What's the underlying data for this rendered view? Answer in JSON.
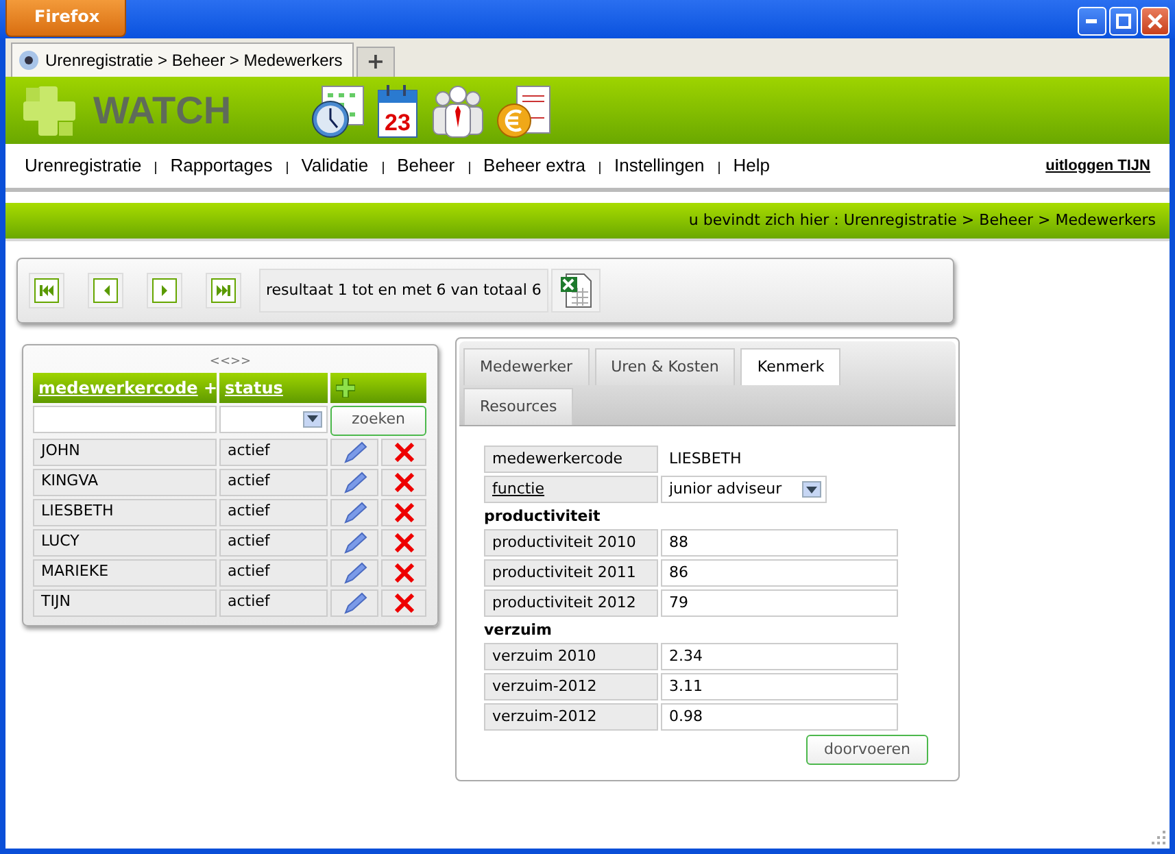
{
  "browser": {
    "menu_button": "Firefox",
    "tab_title": "Urenregistratie > Beheer > Medewerkers",
    "new_tab": "+"
  },
  "app": {
    "logo": "WATCH",
    "nav": [
      "Urenregistratie",
      "Rapportages",
      "Validatie",
      "Beheer",
      "Beheer extra",
      "Instellingen",
      "Help"
    ],
    "logout": "uitloggen TIJN",
    "breadcrumb": "u bevindt zich hier : Urenregistratie > Beheer > Medewerkers",
    "calendar_day": "23"
  },
  "pager": {
    "result": "resultaat 1 tot en met 6 van totaal 6"
  },
  "employees": {
    "scroller": "<<>>",
    "columns": [
      {
        "label": "medewerkercode",
        "sort": "+"
      },
      {
        "label": "status"
      }
    ],
    "search_button": "zoeken",
    "rows": [
      {
        "code": "JOHN",
        "status": "actief"
      },
      {
        "code": "KINGVA",
        "status": "actief"
      },
      {
        "code": "LIESBETH",
        "status": "actief"
      },
      {
        "code": "LUCY",
        "status": "actief"
      },
      {
        "code": "MARIEKE",
        "status": "actief"
      },
      {
        "code": "TIJN",
        "status": "actief"
      }
    ]
  },
  "detail": {
    "tabs": [
      {
        "label": "Medewerker",
        "selected": false
      },
      {
        "label": "Uren & Kosten",
        "selected": false
      },
      {
        "label": "Kenmerk",
        "selected": true
      },
      {
        "label": "Resources",
        "selected": false
      }
    ],
    "code_label": "medewerkercode",
    "code_value": "LIESBETH",
    "function_label": "functie",
    "function_value": "junior adviseur",
    "sections": [
      {
        "heading": "productiviteit",
        "fields": [
          {
            "label": "productiviteit 2010",
            "value": "88"
          },
          {
            "label": "productiviteit 2011",
            "value": "86"
          },
          {
            "label": "productiviteit 2012",
            "value": "79"
          }
        ]
      },
      {
        "heading": "verzuim",
        "fields": [
          {
            "label": "verzuim 2010",
            "value": "2.34"
          },
          {
            "label": "verzuim-2012",
            "value": "3.11"
          },
          {
            "label": "verzuim-2012",
            "value": "0.98"
          }
        ]
      }
    ],
    "submit": "doorvoeren"
  }
}
